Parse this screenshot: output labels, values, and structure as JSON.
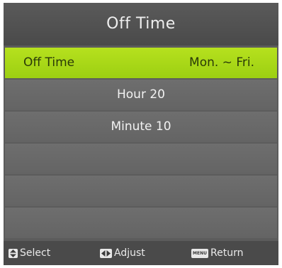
{
  "title": "Off Time",
  "rows": [
    {
      "label": "Off Time",
      "value": "Mon. ~ Fri."
    },
    {
      "text": "Hour 20"
    },
    {
      "text": "Minute 10"
    },
    {
      "text": ""
    },
    {
      "text": ""
    },
    {
      "text": ""
    }
  ],
  "footer": {
    "select_label": "Select",
    "adjust_label": "Adjust",
    "return_label": "Return",
    "menu_key_text": "MENU"
  },
  "colors": {
    "highlight": "#a6d416",
    "panel": "#5c5c5c",
    "row": "#696969"
  }
}
